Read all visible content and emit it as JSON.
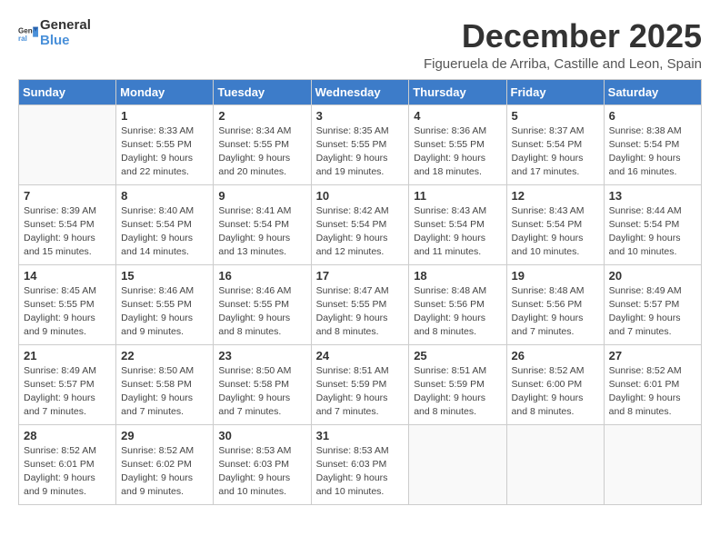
{
  "logo": {
    "general": "General",
    "blue": "Blue"
  },
  "title": "December 2025",
  "subtitle": "Figueruela de Arriba, Castille and Leon, Spain",
  "days_header": [
    "Sunday",
    "Monday",
    "Tuesday",
    "Wednesday",
    "Thursday",
    "Friday",
    "Saturday"
  ],
  "weeks": [
    [
      {
        "day": "",
        "info": ""
      },
      {
        "day": "1",
        "info": "Sunrise: 8:33 AM\nSunset: 5:55 PM\nDaylight: 9 hours\nand 22 minutes."
      },
      {
        "day": "2",
        "info": "Sunrise: 8:34 AM\nSunset: 5:55 PM\nDaylight: 9 hours\nand 20 minutes."
      },
      {
        "day": "3",
        "info": "Sunrise: 8:35 AM\nSunset: 5:55 PM\nDaylight: 9 hours\nand 19 minutes."
      },
      {
        "day": "4",
        "info": "Sunrise: 8:36 AM\nSunset: 5:55 PM\nDaylight: 9 hours\nand 18 minutes."
      },
      {
        "day": "5",
        "info": "Sunrise: 8:37 AM\nSunset: 5:54 PM\nDaylight: 9 hours\nand 17 minutes."
      },
      {
        "day": "6",
        "info": "Sunrise: 8:38 AM\nSunset: 5:54 PM\nDaylight: 9 hours\nand 16 minutes."
      }
    ],
    [
      {
        "day": "7",
        "info": "Sunrise: 8:39 AM\nSunset: 5:54 PM\nDaylight: 9 hours\nand 15 minutes."
      },
      {
        "day": "8",
        "info": "Sunrise: 8:40 AM\nSunset: 5:54 PM\nDaylight: 9 hours\nand 14 minutes."
      },
      {
        "day": "9",
        "info": "Sunrise: 8:41 AM\nSunset: 5:54 PM\nDaylight: 9 hours\nand 13 minutes."
      },
      {
        "day": "10",
        "info": "Sunrise: 8:42 AM\nSunset: 5:54 PM\nDaylight: 9 hours\nand 12 minutes."
      },
      {
        "day": "11",
        "info": "Sunrise: 8:43 AM\nSunset: 5:54 PM\nDaylight: 9 hours\nand 11 minutes."
      },
      {
        "day": "12",
        "info": "Sunrise: 8:43 AM\nSunset: 5:54 PM\nDaylight: 9 hours\nand 10 minutes."
      },
      {
        "day": "13",
        "info": "Sunrise: 8:44 AM\nSunset: 5:54 PM\nDaylight: 9 hours\nand 10 minutes."
      }
    ],
    [
      {
        "day": "14",
        "info": "Sunrise: 8:45 AM\nSunset: 5:55 PM\nDaylight: 9 hours\nand 9 minutes."
      },
      {
        "day": "15",
        "info": "Sunrise: 8:46 AM\nSunset: 5:55 PM\nDaylight: 9 hours\nand 9 minutes."
      },
      {
        "day": "16",
        "info": "Sunrise: 8:46 AM\nSunset: 5:55 PM\nDaylight: 9 hours\nand 8 minutes."
      },
      {
        "day": "17",
        "info": "Sunrise: 8:47 AM\nSunset: 5:55 PM\nDaylight: 9 hours\nand 8 minutes."
      },
      {
        "day": "18",
        "info": "Sunrise: 8:48 AM\nSunset: 5:56 PM\nDaylight: 9 hours\nand 8 minutes."
      },
      {
        "day": "19",
        "info": "Sunrise: 8:48 AM\nSunset: 5:56 PM\nDaylight: 9 hours\nand 7 minutes."
      },
      {
        "day": "20",
        "info": "Sunrise: 8:49 AM\nSunset: 5:57 PM\nDaylight: 9 hours\nand 7 minutes."
      }
    ],
    [
      {
        "day": "21",
        "info": "Sunrise: 8:49 AM\nSunset: 5:57 PM\nDaylight: 9 hours\nand 7 minutes."
      },
      {
        "day": "22",
        "info": "Sunrise: 8:50 AM\nSunset: 5:58 PM\nDaylight: 9 hours\nand 7 minutes."
      },
      {
        "day": "23",
        "info": "Sunrise: 8:50 AM\nSunset: 5:58 PM\nDaylight: 9 hours\nand 7 minutes."
      },
      {
        "day": "24",
        "info": "Sunrise: 8:51 AM\nSunset: 5:59 PM\nDaylight: 9 hours\nand 7 minutes."
      },
      {
        "day": "25",
        "info": "Sunrise: 8:51 AM\nSunset: 5:59 PM\nDaylight: 9 hours\nand 8 minutes."
      },
      {
        "day": "26",
        "info": "Sunrise: 8:52 AM\nSunset: 6:00 PM\nDaylight: 9 hours\nand 8 minutes."
      },
      {
        "day": "27",
        "info": "Sunrise: 8:52 AM\nSunset: 6:01 PM\nDaylight: 9 hours\nand 8 minutes."
      }
    ],
    [
      {
        "day": "28",
        "info": "Sunrise: 8:52 AM\nSunset: 6:01 PM\nDaylight: 9 hours\nand 9 minutes."
      },
      {
        "day": "29",
        "info": "Sunrise: 8:52 AM\nSunset: 6:02 PM\nDaylight: 9 hours\nand 9 minutes."
      },
      {
        "day": "30",
        "info": "Sunrise: 8:53 AM\nSunset: 6:03 PM\nDaylight: 9 hours\nand 10 minutes."
      },
      {
        "day": "31",
        "info": "Sunrise: 8:53 AM\nSunset: 6:03 PM\nDaylight: 9 hours\nand 10 minutes."
      },
      {
        "day": "",
        "info": ""
      },
      {
        "day": "",
        "info": ""
      },
      {
        "day": "",
        "info": ""
      }
    ]
  ]
}
